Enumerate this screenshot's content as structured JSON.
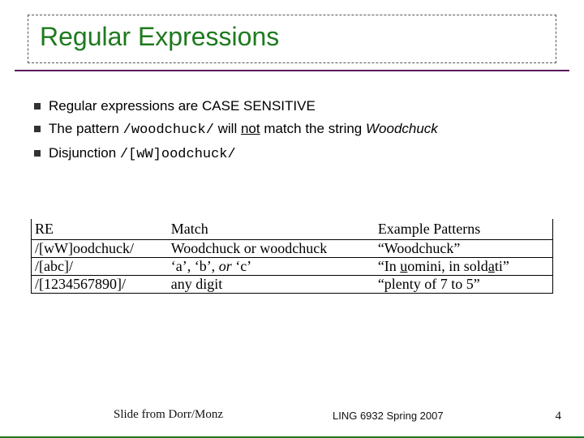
{
  "title": "Regular Expressions",
  "bullets": {
    "b1": "Regular expressions are CASE SENSITIVE",
    "b2_pre": "The pattern ",
    "b2_code": "/woodchuck/",
    "b2_mid": " will ",
    "b2_not": "not",
    "b2_post": " match the string ",
    "b2_ital": "Woodchuck",
    "b3_pre": "Disjunction ",
    "b3_code": "/[wW]oodchuck/"
  },
  "table": {
    "headers": {
      "re": "RE",
      "match": "Match",
      "ex": "Example Patterns"
    },
    "rows": [
      {
        "re": "/[wW]oodchuck/",
        "match": "Woodchuck or woodchuck",
        "ex": "“Woodchuck”"
      },
      {
        "re": "/[abc]/",
        "match_pre": "‘a’, ‘b’, ",
        "match_ital": "or",
        "match_post": " ‘c’",
        "ex_pre": "“In ",
        "ex_u1": "u",
        "ex_mid": "omini, in sold",
        "ex_u2": "a",
        "ex_post": "ti”"
      },
      {
        "re": "/[1234567890]/",
        "match": "any digit",
        "ex": "“plenty of 7 to 5”"
      }
    ]
  },
  "footer": {
    "left": "Slide from Dorr/Monz",
    "center": "LING 6932 Spring 2007",
    "right": "4"
  }
}
